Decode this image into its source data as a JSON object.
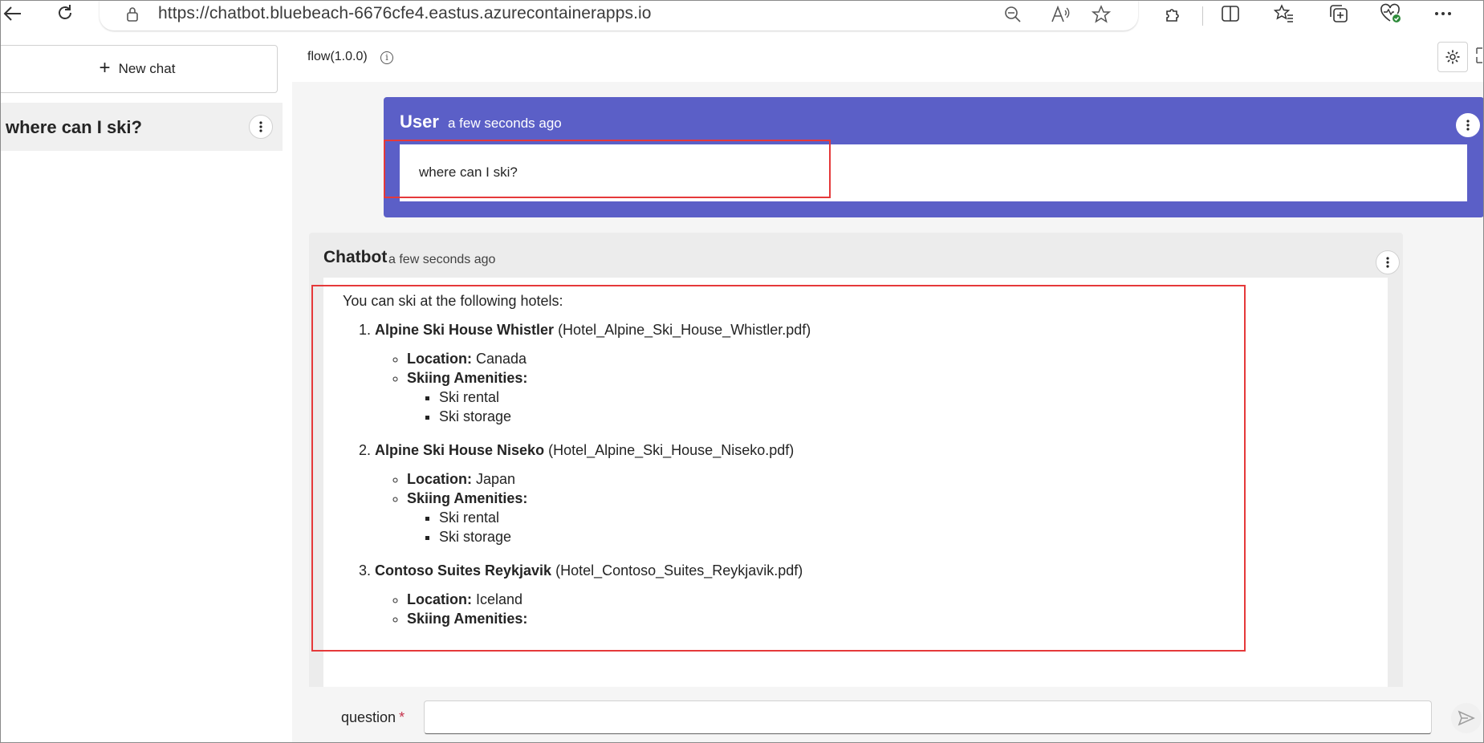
{
  "browser": {
    "url": "https://chatbot.bluebeach-6676cfe4.eastus.azurecontainerapps.io",
    "icons": [
      "back-icon",
      "refresh-icon",
      "lock-icon",
      "zoom-out-icon",
      "read-aloud-icon",
      "favorite-star-icon",
      "extensions-icon",
      "split-screen-icon",
      "favorites-icon",
      "collections-icon",
      "browser-essentials-icon",
      "more-icon"
    ]
  },
  "sidebar": {
    "new_chat_label": "New chat",
    "sessions": [
      {
        "title": "where can I ski?"
      }
    ]
  },
  "header": {
    "flow_label": "flow(1.0.0)"
  },
  "messages": {
    "user": {
      "name": "User",
      "time": "a few seconds ago",
      "text": "where can I ski?"
    },
    "bot": {
      "name": "Chatbot",
      "time": "a few seconds ago",
      "intro": "You can ski at the following hotels:",
      "hotels": [
        {
          "name": "Alpine Ski House Whistler",
          "source": "(Hotel_Alpine_Ski_House_Whistler.pdf)",
          "location_label": "Location:",
          "location": "Canada",
          "amenities_label": "Skiing Amenities:",
          "amenities": [
            "Ski rental",
            "Ski storage"
          ]
        },
        {
          "name": "Alpine Ski House Niseko",
          "source": "(Hotel_Alpine_Ski_House_Niseko.pdf)",
          "location_label": "Location:",
          "location": "Japan",
          "amenities_label": "Skiing Amenities:",
          "amenities": [
            "Ski rental",
            "Ski storage"
          ]
        },
        {
          "name": "Contoso Suites Reykjavik",
          "source": "(Hotel_Contoso_Suites_Reykjavik.pdf)",
          "location_label": "Location:",
          "location": "Iceland",
          "amenities_label": "Skiing Amenities:",
          "amenities": []
        }
      ]
    }
  },
  "input": {
    "label": "question",
    "required_mark": "*",
    "value": ""
  },
  "colors": {
    "user_card": "#5b5fc7",
    "highlight": "#e5393a",
    "chat_bg": "#f5f5f5",
    "bot_card": "#ececec"
  }
}
